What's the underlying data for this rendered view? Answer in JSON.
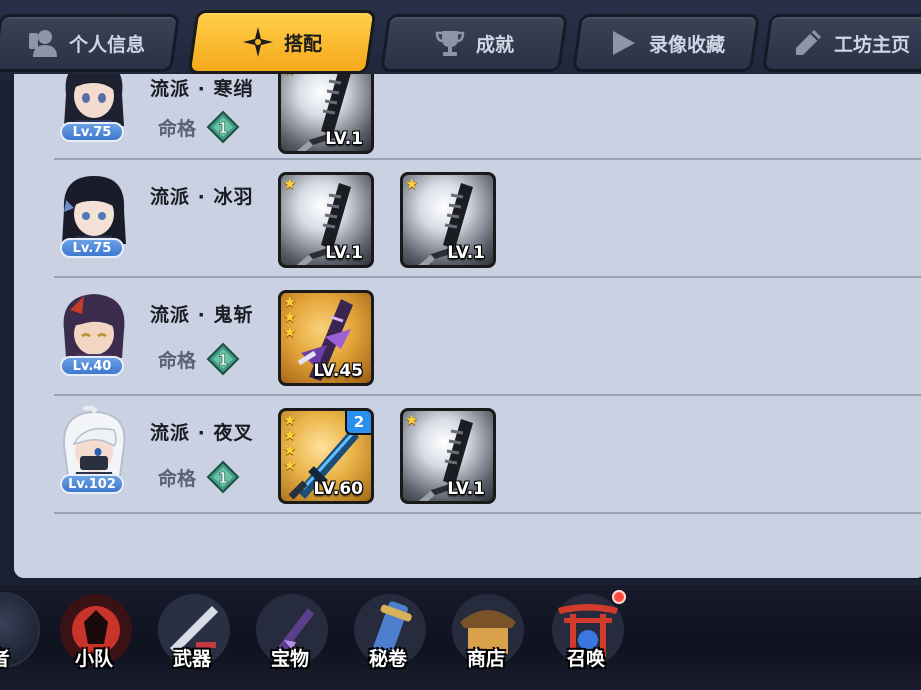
{
  "tabs": [
    {
      "label": "个人信息",
      "icon": "profile-icon",
      "active": false
    },
    {
      "label": "搭配",
      "icon": "shuriken-icon",
      "active": true
    },
    {
      "label": "成就",
      "icon": "trophy-icon",
      "active": false
    },
    {
      "label": "录像收藏",
      "icon": "play-icon",
      "active": false
    },
    {
      "label": "工坊主页",
      "icon": "pencil-icon",
      "active": false
    }
  ],
  "fate_label": "命格",
  "rows": [
    {
      "level": "Lv.75",
      "school": "流派 · 寒绡",
      "fate": "1",
      "weapons": [
        {
          "level": "LV.1",
          "stars": 1,
          "style": "silver"
        }
      ]
    },
    {
      "level": "Lv.75",
      "school": "流派 · 冰羽",
      "fate": null,
      "weapons": [
        {
          "level": "LV.1",
          "stars": 1,
          "style": "silver"
        },
        {
          "level": "LV.1",
          "stars": 1,
          "style": "silver"
        }
      ]
    },
    {
      "level": "Lv.40",
      "school": "流派 · 鬼斩",
      "fate": "1",
      "weapons": [
        {
          "level": "LV.45",
          "stars": 3,
          "style": "gold"
        }
      ]
    },
    {
      "level": "Lv.102",
      "school": "流派 · 夜叉",
      "fate": "1",
      "weapons": [
        {
          "level": "LV.60",
          "stars": 4,
          "style": "blue",
          "refine": "2"
        },
        {
          "level": "LV.1",
          "stars": 1,
          "style": "silver"
        }
      ]
    }
  ],
  "dock": [
    {
      "label": "者"
    },
    {
      "label": "小队"
    },
    {
      "label": "武器"
    },
    {
      "label": "宝物"
    },
    {
      "label": "秘卷"
    },
    {
      "label": "商店"
    },
    {
      "label": "召唤"
    }
  ],
  "colors": {
    "active_tab": "#f6a91a",
    "panel": "#c9d1e3",
    "level_badge": "#3f78cf",
    "fate_badge": "#3f9a82",
    "star": "#ffd23a"
  }
}
